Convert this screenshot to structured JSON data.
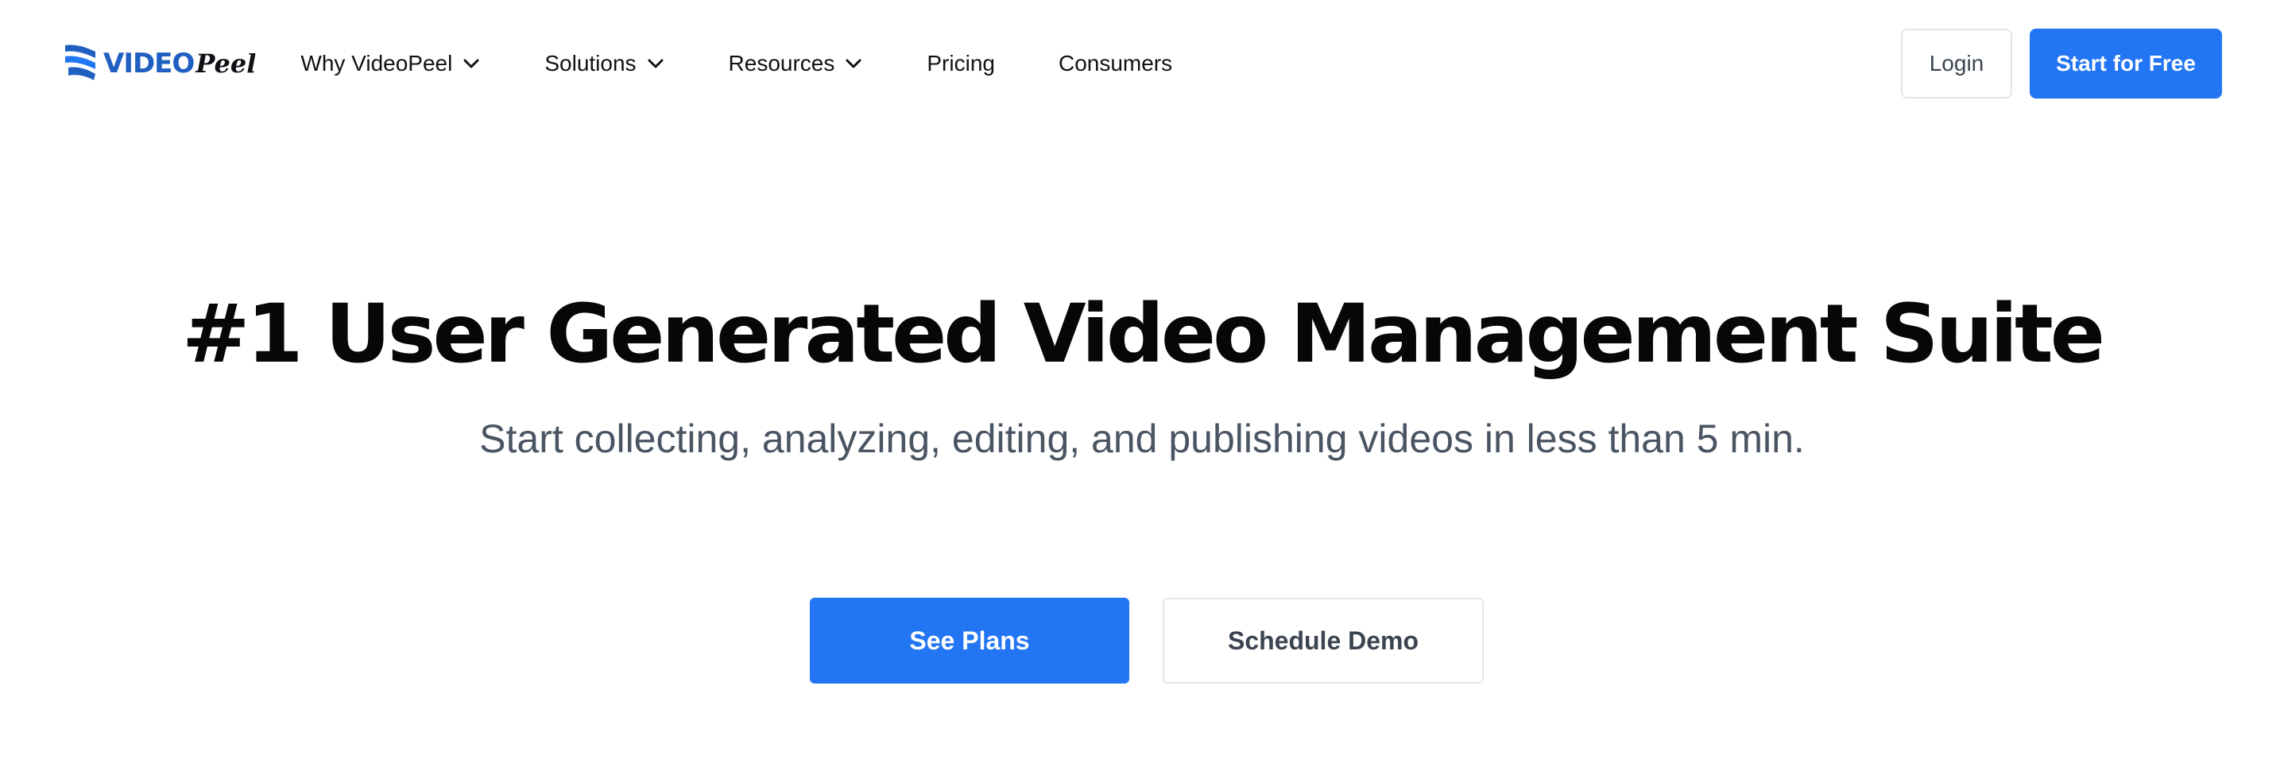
{
  "brand": {
    "name_part1": "VIDEO",
    "name_part2": "Peel",
    "logo_icon": "ribbon-logo-icon",
    "primary_color": "#2376f3",
    "logo_color": "#1f5fc2"
  },
  "nav": {
    "items": [
      {
        "label": "Why VideoPeel",
        "has_dropdown": true,
        "icon": "chevron-down-icon"
      },
      {
        "label": "Solutions",
        "has_dropdown": true,
        "icon": "chevron-down-icon"
      },
      {
        "label": "Resources",
        "has_dropdown": true,
        "icon": "chevron-down-icon"
      },
      {
        "label": "Pricing",
        "has_dropdown": false
      },
      {
        "label": "Consumers",
        "has_dropdown": false
      }
    ],
    "login_label": "Login",
    "start_label": "Start for Free"
  },
  "hero": {
    "title": "#1 User Generated Video Management Suite",
    "subtitle": "Start collecting, analyzing, editing, and publishing videos in less than 5 min.",
    "primary_cta": "See Plans",
    "secondary_cta": "Schedule Demo"
  }
}
